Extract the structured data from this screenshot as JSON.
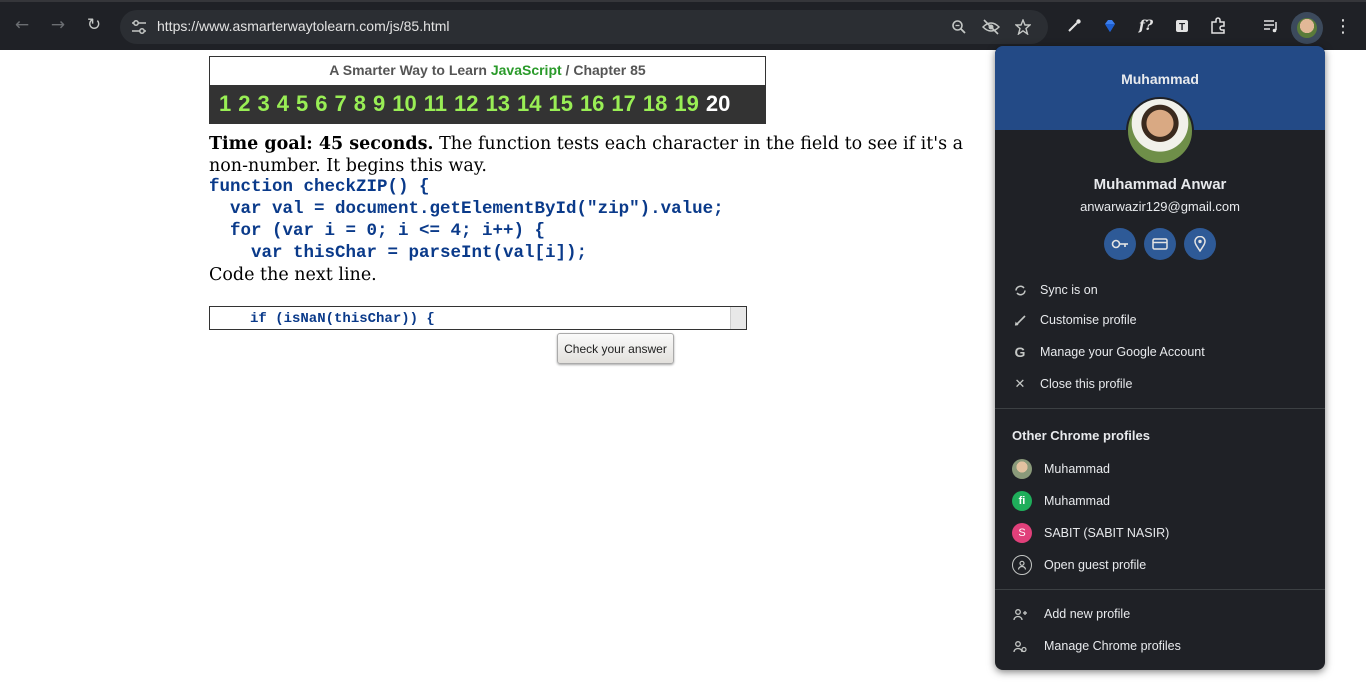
{
  "browser": {
    "url": "https://www.asmarterwaytolearn.com/js/85.html"
  },
  "page": {
    "banner_prefix": "A Smarter Way to Learn ",
    "banner_js": "JavaScript",
    "banner_suffix": " / Chapter 85",
    "exercises": [
      "1",
      "2",
      "3",
      "4",
      "5",
      "6",
      "7",
      "8",
      "9",
      "10",
      "11",
      "12",
      "13",
      "14",
      "15",
      "16",
      "17",
      "18",
      "19",
      "20"
    ],
    "current_exercise": "20",
    "goal_bold": "Time goal: 45 seconds.",
    "goal_text": " The function tests each character in the field to see if it's a non-number. It begins this way.",
    "code_lines": [
      "function checkZIP() {",
      "  var val = document.getElementById(\"zip\").value;",
      "  for (var i = 0; i <= 4; i++) {",
      "    var thisChar = parseInt(val[i]);"
    ],
    "instruction": "Code the next line.",
    "answer_value": "if (isNaN(thisChar)) {",
    "check_button": "Check your answer"
  },
  "profile": {
    "header_name": "Muhammad",
    "full_name": "Muhammad Anwar",
    "email": "anwarwazir129@gmail.com",
    "quick_icons": [
      "key-icon",
      "card-icon",
      "location-icon"
    ],
    "menu": [
      {
        "label": "Sync is on",
        "icon": "sync-icon"
      },
      {
        "label": "Customise profile",
        "icon": "pencil-icon"
      },
      {
        "label": "Manage your Google Account",
        "icon": "google-icon"
      },
      {
        "label": "Close this profile",
        "icon": "close-icon"
      }
    ],
    "other_title": "Other Chrome profiles",
    "others": [
      {
        "label": "Muhammad",
        "icon": "photo-avatar",
        "color": "#8a9a7a"
      },
      {
        "label": "Muhammad",
        "icon": "fi",
        "color": "#1fae5b"
      },
      {
        "label": "SABIT (SABIT NASIR)",
        "icon": "S",
        "color": "#e0407a"
      },
      {
        "label": "Open guest profile",
        "icon": "guest-icon"
      }
    ],
    "footer": [
      {
        "label": "Add new profile",
        "icon": "add-person-icon"
      },
      {
        "label": "Manage Chrome profiles",
        "icon": "manage-people-icon"
      }
    ]
  }
}
